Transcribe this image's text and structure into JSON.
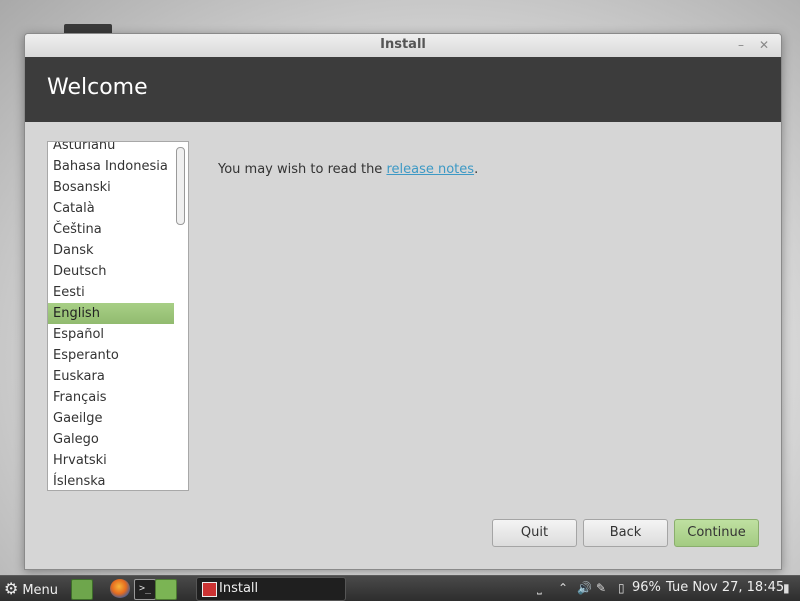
{
  "window": {
    "title": "Install",
    "minimize_icon": "minimize-icon",
    "close_icon": "close-icon"
  },
  "banner": {
    "title": "Welcome"
  },
  "languages": {
    "items": [
      "Asturianu",
      "Bahasa Indonesia",
      "Bosanski",
      "Català",
      "Čeština",
      "Dansk",
      "Deutsch",
      "Eesti",
      "English",
      "Español",
      "Esperanto",
      "Euskara",
      "Français",
      "Gaeilge",
      "Galego",
      "Hrvatski",
      "Íslenska"
    ],
    "selected": "English"
  },
  "notes": {
    "prefix": "You may wish to read the ",
    "link": "release notes",
    "suffix": "."
  },
  "buttons": {
    "quit": "Quit",
    "back": "Back",
    "continue": "Continue"
  },
  "taskbar": {
    "menu_label": "Menu",
    "task_label": "Install",
    "battery": "96%",
    "clock": "Tue Nov 27, 18:45"
  },
  "colors": {
    "selection": "#9bc27a",
    "banner": "#3c3c3c",
    "link": "#3d99c5"
  }
}
